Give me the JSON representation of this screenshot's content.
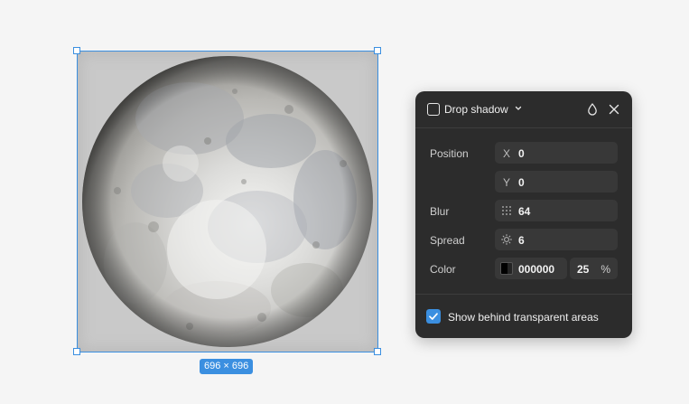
{
  "canvas": {
    "size_badge": "696 × 696",
    "selection_color": "#3b8fe0",
    "frame_image": "moon"
  },
  "panel": {
    "title": "Drop shadow",
    "header_icons": [
      "effect-square-icon",
      "chevron-down-icon",
      "drop-icon",
      "close-icon"
    ],
    "position_label": "Position",
    "x_prefix": "X",
    "x_value": "0",
    "y_prefix": "Y",
    "y_value": "0",
    "blur_label": "Blur",
    "blur_value": "64",
    "spread_label": "Spread",
    "spread_value": "6",
    "color_label": "Color",
    "color_hex": "000000",
    "opacity_value": "25",
    "opacity_unit": "%",
    "show_behind_label": "Show behind transparent areas",
    "show_behind_checked": true,
    "colors": {
      "background": "#2c2c2c",
      "field": "#383838",
      "accent": "#3b8fe0",
      "swatch": "#000000"
    }
  }
}
